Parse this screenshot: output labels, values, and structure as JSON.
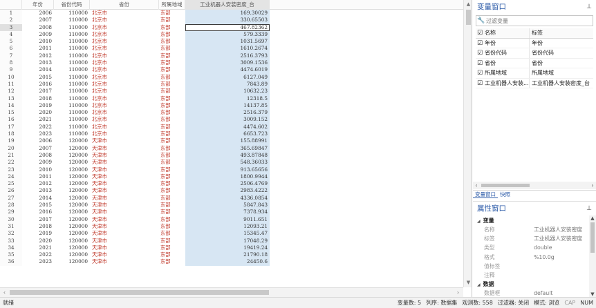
{
  "grid": {
    "columns": [
      "年份",
      "省份代码",
      "省份",
      "所属地域",
      "工业机器人安装密度_台"
    ],
    "rows": [
      [
        "1",
        "2006",
        "110000",
        "北京市",
        "东部",
        "169.30029"
      ],
      [
        "2",
        "2007",
        "110000",
        "北京市",
        "东部",
        "330.65503"
      ],
      [
        "3",
        "2008",
        "110000",
        "北京市",
        "东部",
        "467.82362"
      ],
      [
        "4",
        "2009",
        "110000",
        "北京市",
        "东部",
        "579.3339"
      ],
      [
        "5",
        "2010",
        "110000",
        "北京市",
        "东部",
        "1031.5697"
      ],
      [
        "6",
        "2011",
        "110000",
        "北京市",
        "东部",
        "1610.2674"
      ],
      [
        "7",
        "2012",
        "110000",
        "北京市",
        "东部",
        "2516.3793"
      ],
      [
        "8",
        "2013",
        "110000",
        "北京市",
        "东部",
        "3009.1536"
      ],
      [
        "9",
        "2014",
        "110000",
        "北京市",
        "东部",
        "4474.6019"
      ],
      [
        "10",
        "2015",
        "110000",
        "北京市",
        "东部",
        "6127.049"
      ],
      [
        "11",
        "2016",
        "110000",
        "北京市",
        "东部",
        "7843.89"
      ],
      [
        "12",
        "2017",
        "110000",
        "北京市",
        "东部",
        "10632.23"
      ],
      [
        "13",
        "2018",
        "110000",
        "北京市",
        "东部",
        "12318.5"
      ],
      [
        "14",
        "2019",
        "110000",
        "北京市",
        "东部",
        "14137.85"
      ],
      [
        "15",
        "2020",
        "110000",
        "北京市",
        "东部",
        "2516.379"
      ],
      [
        "16",
        "2021",
        "110000",
        "北京市",
        "东部",
        "3009.152"
      ],
      [
        "17",
        "2022",
        "110000",
        "北京市",
        "东部",
        "4474.602"
      ],
      [
        "18",
        "2023",
        "110000",
        "北京市",
        "东部",
        "6653.723"
      ],
      [
        "19",
        "2006",
        "120000",
        "天津市",
        "东部",
        "155.88991"
      ],
      [
        "20",
        "2007",
        "120000",
        "天津市",
        "东部",
        "365.69847"
      ],
      [
        "21",
        "2008",
        "120000",
        "天津市",
        "东部",
        "493.87848"
      ],
      [
        "22",
        "2009",
        "120000",
        "天津市",
        "东部",
        "548.36033"
      ],
      [
        "23",
        "2010",
        "120000",
        "天津市",
        "东部",
        "913.65656"
      ],
      [
        "24",
        "2011",
        "120000",
        "天津市",
        "东部",
        "1800.9944"
      ],
      [
        "25",
        "2012",
        "120000",
        "天津市",
        "东部",
        "2506.4769"
      ],
      [
        "26",
        "2013",
        "120000",
        "天津市",
        "东部",
        "2983.4222"
      ],
      [
        "27",
        "2014",
        "120000",
        "天津市",
        "东部",
        "4336.0854"
      ],
      [
        "28",
        "2015",
        "120000",
        "天津市",
        "东部",
        "5847.843"
      ],
      [
        "29",
        "2016",
        "120000",
        "天津市",
        "东部",
        "7378.934"
      ],
      [
        "30",
        "2017",
        "120000",
        "天津市",
        "东部",
        "9011.651"
      ],
      [
        "31",
        "2018",
        "120000",
        "天津市",
        "东部",
        "12093.21"
      ],
      [
        "32",
        "2019",
        "120000",
        "天津市",
        "东部",
        "15345.47"
      ],
      [
        "33",
        "2020",
        "120000",
        "天津市",
        "东部",
        "17048.29"
      ],
      [
        "34",
        "2021",
        "120000",
        "天津市",
        "东部",
        "19419.24"
      ],
      [
        "35",
        "2022",
        "120000",
        "天津市",
        "东部",
        "21790.18"
      ],
      [
        "36",
        "2023",
        "120000",
        "天津市",
        "东部",
        "24450.6"
      ]
    ],
    "selected_row": 3
  },
  "variable_window": {
    "title": "变量窗口",
    "filter_placeholder": "过滤变量",
    "header": {
      "name": "名称",
      "label": "标签"
    },
    "variables": [
      {
        "name": "年份",
        "label": "年份"
      },
      {
        "name": "省份代码",
        "label": "省份代码"
      },
      {
        "name": "省份",
        "label": "省份"
      },
      {
        "name": "所属地域",
        "label": "所属地域"
      },
      {
        "name": "工业机器人安装...",
        "label": "工业机器人安装密度_台"
      }
    ],
    "tabs": [
      "变量窗口",
      "快照"
    ]
  },
  "property_window": {
    "title": "属性窗口",
    "sections": [
      {
        "name": "变量",
        "rows": [
          {
            "key": "名称",
            "value": "工业机器人安装密度"
          },
          {
            "key": "标签",
            "value": "工业机器人安装密度"
          },
          {
            "key": "类型",
            "value": "double"
          },
          {
            "key": "格式",
            "value": "%10.0g"
          },
          {
            "key": "值标签",
            "value": ""
          },
          {
            "key": "注释",
            "value": ""
          }
        ]
      },
      {
        "name": "数据",
        "rows": [
          {
            "key": "数据框",
            "value": "default"
          }
        ]
      }
    ]
  },
  "status_bar": {
    "ready": "就绪",
    "var_count": "变量数: 5",
    "sort": "列序: 数据集",
    "obs_count": "观测数: 558",
    "filter": "过滤器: 关闭",
    "mode": "模式: 浏览",
    "cap": "CAP",
    "num": "NUM"
  }
}
